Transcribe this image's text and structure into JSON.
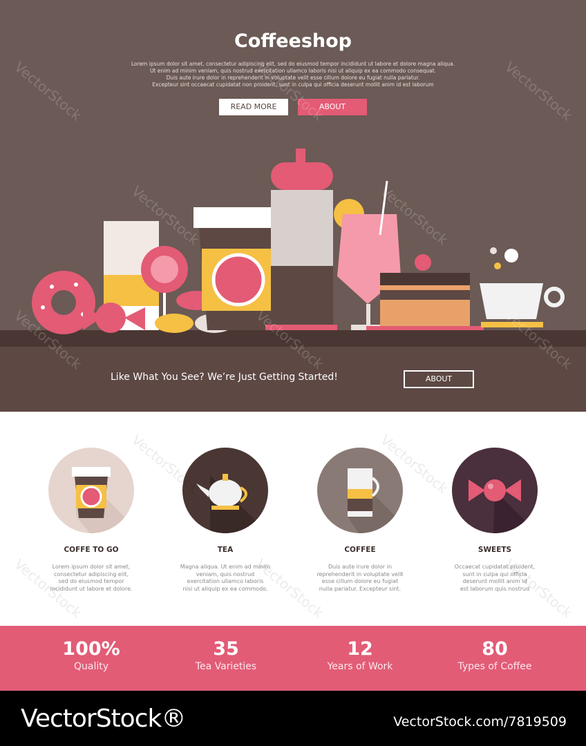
{
  "hero": {
    "title": "Coffeeshop",
    "text_lines": [
      "Lorem ipsum dolor sit amet, consectetur adipiscing elit, sed do eiusmod tempor incididunt ut labore et dolore magna aliqua.",
      "Ut enim ad minim veniam, quis nostrud exercitation ullamco laboris nisi ut aliquip ex ea commodo consequat.",
      "Duis aute irure dolor in reprehenderit in voluptate velit esse cillum dolore eu fugiat nulla pariatur.",
      "Excepteur sint occaecat cupidatat non proident, sunt in culpa qui officia deserunt mollit anim id est laborum"
    ],
    "read_more": "READ MORE",
    "about": "ABOUT"
  },
  "cta": {
    "text": "Like What You See? We’re Just Getting Started!",
    "about": "ABOUT"
  },
  "features": [
    {
      "title": "COFFE TO GO",
      "icon": "coffee-cup-to-go-icon",
      "desc": [
        "Lorem ipsum dolor sit amet,",
        "consectetur adipiscing elit,",
        "sed do eiusmod tempor",
        "incididunt ut labore et dolore."
      ]
    },
    {
      "title": "TEA",
      "icon": "teapot-icon",
      "desc": [
        "Magna aliqua. Ut enim ad minim",
        "veniam, quis nostrud",
        "exercitation ullamco laboris",
        "nisi ut aliquip ex ea commodo."
      ]
    },
    {
      "title": "COFFEE",
      "icon": "latte-glass-icon",
      "desc": [
        "Duis aute irure dolor in",
        "reprehenderit in voluptate velit",
        "esse cillum dolore eu fugiat",
        "nulla pariatur. Excepteur sint."
      ]
    },
    {
      "title": "SWEETS",
      "icon": "candy-icon",
      "desc": [
        "Occaecat cupidatat proident,",
        "sunt in culpa qui officia",
        "deserunt mollit anim id",
        "est laborum quis nostrud"
      ]
    }
  ],
  "stats": [
    {
      "num": "100%",
      "label": "Quality"
    },
    {
      "num": "35",
      "label": "Tea Varieties"
    },
    {
      "num": "12",
      "label": "Years of Work"
    },
    {
      "num": "80",
      "label": "Types of Coffee"
    }
  ],
  "footer": {
    "brand": "VectorStock®",
    "id": "VectorStock.com/7819509"
  },
  "watermark": "VectorStock",
  "colors": {
    "brown_bg": "#6b5a55",
    "dark_brown": "#5d4844",
    "pink": "#e25c76",
    "white": "#ffffff"
  }
}
